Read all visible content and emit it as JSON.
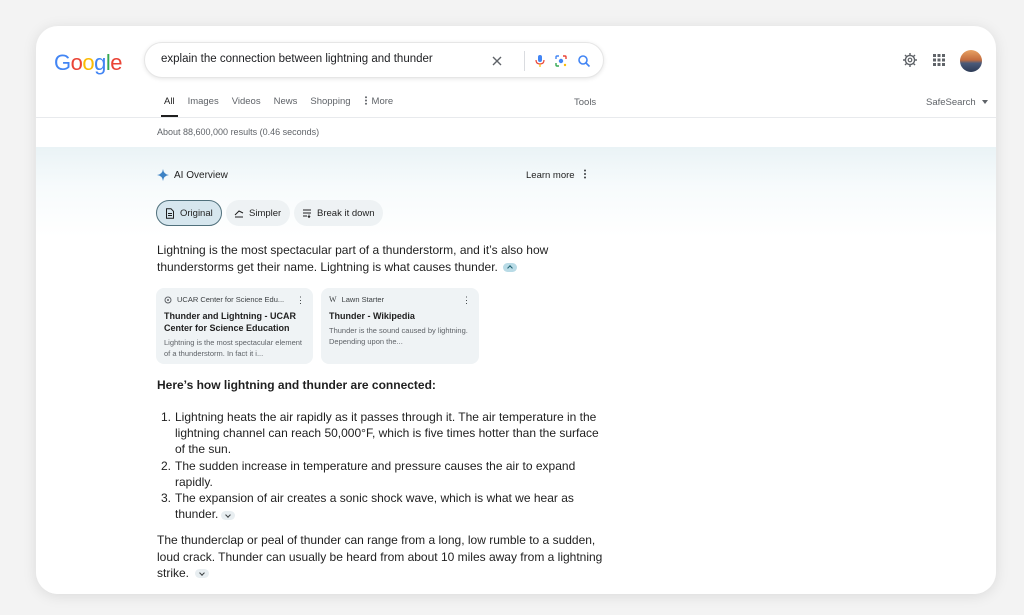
{
  "logo": {
    "letters": [
      "G",
      "o",
      "o",
      "g",
      "l",
      "e"
    ],
    "colors": [
      "#4285F4",
      "#EA4335",
      "#FBBC05",
      "#4285F4",
      "#34A853",
      "#EA4335"
    ]
  },
  "search": {
    "query": "explain the connection between lightning and thunder"
  },
  "tabs": [
    {
      "label": "All",
      "active": true
    },
    {
      "label": "Images"
    },
    {
      "label": "Videos"
    },
    {
      "label": "News"
    },
    {
      "label": "Shopping"
    },
    {
      "label": "More"
    }
  ],
  "tools_label": "Tools",
  "safesearch_label": "SafeSearch",
  "results_stats": "About 88,600,000 results (0.46 seconds)",
  "ai_overview": {
    "title": "AI Overview",
    "learn_more": "Learn more",
    "modes": {
      "original": "Original",
      "simpler": "Simpler",
      "break_down": "Break it down"
    },
    "intro": "Lightning is the most spectacular part of a thunderstorm, and it’s also how thunderstorms get their name. Lightning is what causes thunder.",
    "sources": [
      {
        "site": "UCAR Center for Science Edu...",
        "title": "Thunder and Lightning - UCAR Center for Science Education",
        "snippet": "Lightning is the most spectacular element of a thunderstorm. In fact it i..."
      },
      {
        "site": "Lawn Starter",
        "title": "Thunder - Wikipedia",
        "snippet": "Thunder is the sound caused by lightning. Depending upon the..."
      }
    ],
    "heading": "Here’s how lightning and thunder are connected:",
    "steps": [
      {
        "num": "1.",
        "text": "Lightning heats the air rapidly as it passes through it. The air temperature in the lightning channel can reach 50,000°F, which is five times hotter than the surface of the sun."
      },
      {
        "num": "2.",
        "text": "The sudden increase in temperature and pressure causes the air to expand rapidly."
      },
      {
        "num": "3.",
        "text": "The expansion of air creates a sonic shock wave, which is what we hear as thunder."
      }
    ],
    "closing": "The thunderclap or peal of thunder can range from a long, low rumble to a sudden, loud crack. Thunder can usually be heard from about 10 miles away from a lightning strike."
  }
}
